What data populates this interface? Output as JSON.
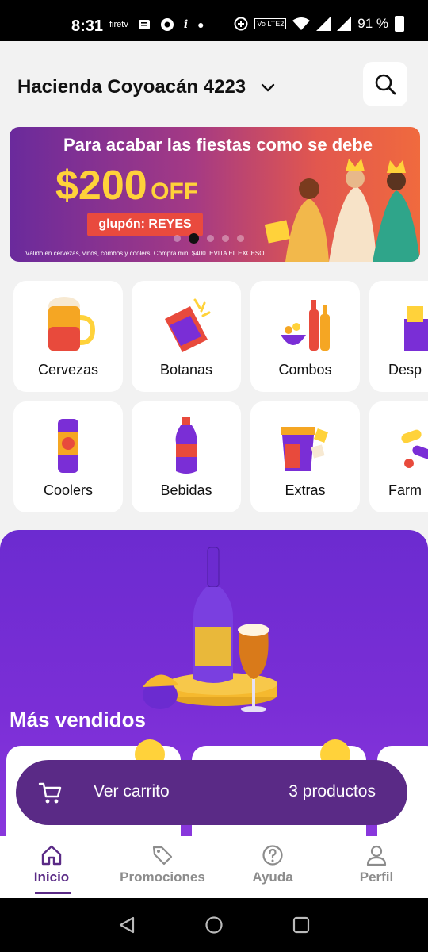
{
  "status_bar": {
    "time": "8:31",
    "left_icons": [
      "firetv-icon",
      "notes-icon",
      "chrome-icon",
      "italic-icon",
      "dot-icon"
    ],
    "firetv_label": "firetv",
    "battery_text": "91 %",
    "network_label": "Vo LTE2"
  },
  "header": {
    "address": "Hacienda Coyoacán 4223",
    "search_icon": "search-icon"
  },
  "banner": {
    "title": "Para acabar las fiestas como se debe",
    "off_amount": "$200",
    "off_label": "OFF",
    "coupon": "glupón: REYES",
    "legal": "Válido en cervezas, vinos, combos y coolers. Compra min. $400. EVITA EL EXCESO.",
    "active_dot": 1,
    "dot_count": 5
  },
  "categories": [
    {
      "label": "Cervezas"
    },
    {
      "label": "Botanas"
    },
    {
      "label": "Combos"
    },
    {
      "label": "Desp"
    },
    {
      "label": "Coolers"
    },
    {
      "label": "Bebidas"
    },
    {
      "label": "Extras"
    },
    {
      "label": "Farm"
    }
  ],
  "promo": {
    "title": "Más vendidos"
  },
  "cart": {
    "label": "Ver carrito",
    "count": "3 productos"
  },
  "bottom_nav": [
    {
      "label": "Inicio",
      "icon": "home-icon",
      "active": true
    },
    {
      "label": "Promociones",
      "icon": "tag-icon",
      "active": false
    },
    {
      "label": "Ayuda",
      "icon": "help-icon",
      "active": false
    },
    {
      "label": "Perfil",
      "icon": "user-icon",
      "active": false
    }
  ],
  "colors": {
    "brand_purple": "#5a2a86",
    "promo_purple": "#7a2ed6",
    "banner_yellow": "#ffd23a",
    "coupon_red": "#e94a3e"
  }
}
